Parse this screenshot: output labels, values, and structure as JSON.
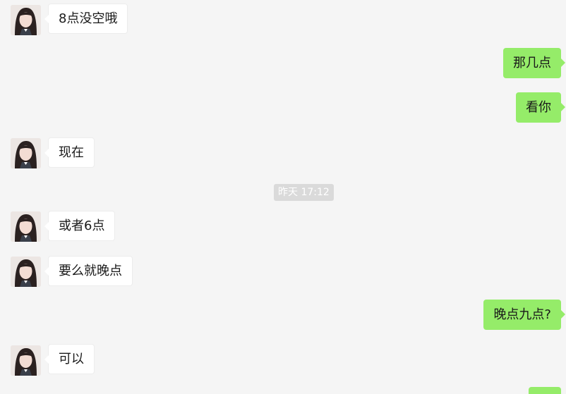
{
  "colors": {
    "background": "#f5f5f5",
    "incoming_bubble": "#ffffff",
    "outgoing_bubble": "#95ec69",
    "timestamp_bg": "#dadada"
  },
  "messages": [
    {
      "direction": "incoming",
      "text": "8点没空哦"
    },
    {
      "direction": "outgoing",
      "text": "那几点"
    },
    {
      "direction": "outgoing",
      "text": "看你"
    },
    {
      "direction": "incoming",
      "text": "现在"
    },
    {
      "direction": "incoming",
      "text": "或者6点"
    },
    {
      "direction": "incoming",
      "text": "要么就晚点"
    },
    {
      "direction": "outgoing",
      "text": "晚点九点?"
    },
    {
      "direction": "incoming",
      "text": "可以"
    }
  ],
  "timestamp": "昨天 17:12",
  "avatar_icon": "contact-avatar-icon"
}
